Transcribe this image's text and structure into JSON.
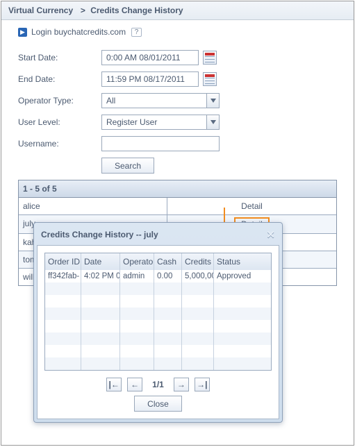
{
  "breadcrumb": {
    "a": "Virtual Currency",
    "b": "Credits Change History"
  },
  "login": {
    "text": "Login buychatcredits.com",
    "help": "?"
  },
  "form": {
    "start_label": "Start Date:",
    "start_value": "0:00 AM 08/01/2011",
    "end_label": "End Date:",
    "end_value": "11:59 PM 08/17/2011",
    "op_label": "Operator Type:",
    "op_value": "All",
    "lvl_label": "User Level:",
    "lvl_value": "Register User",
    "user_label": "Username:",
    "user_value": "",
    "search": "Search"
  },
  "grid": {
    "summary": "1 - 5 of 5",
    "detail_label": "Detail",
    "rows": [
      "alice",
      "july",
      "kahlil",
      "tom",
      "will"
    ]
  },
  "dialog": {
    "title": "Credits Change History -- july",
    "headers": {
      "oid": "Order ID",
      "date": "Date",
      "op": "Operator",
      "cash": "Cash",
      "cred": "Credits",
      "stat": "Status"
    },
    "row": {
      "oid": "ff342fab-",
      "date": "4:02 PM 0",
      "op": "admin",
      "cash": "0.00",
      "cred": "5,000,00",
      "stat": "Approved"
    },
    "page": "1/1",
    "close": "Close",
    "nav": {
      "first": "|←",
      "prev": "←",
      "next": "→",
      "last": "→|"
    }
  }
}
